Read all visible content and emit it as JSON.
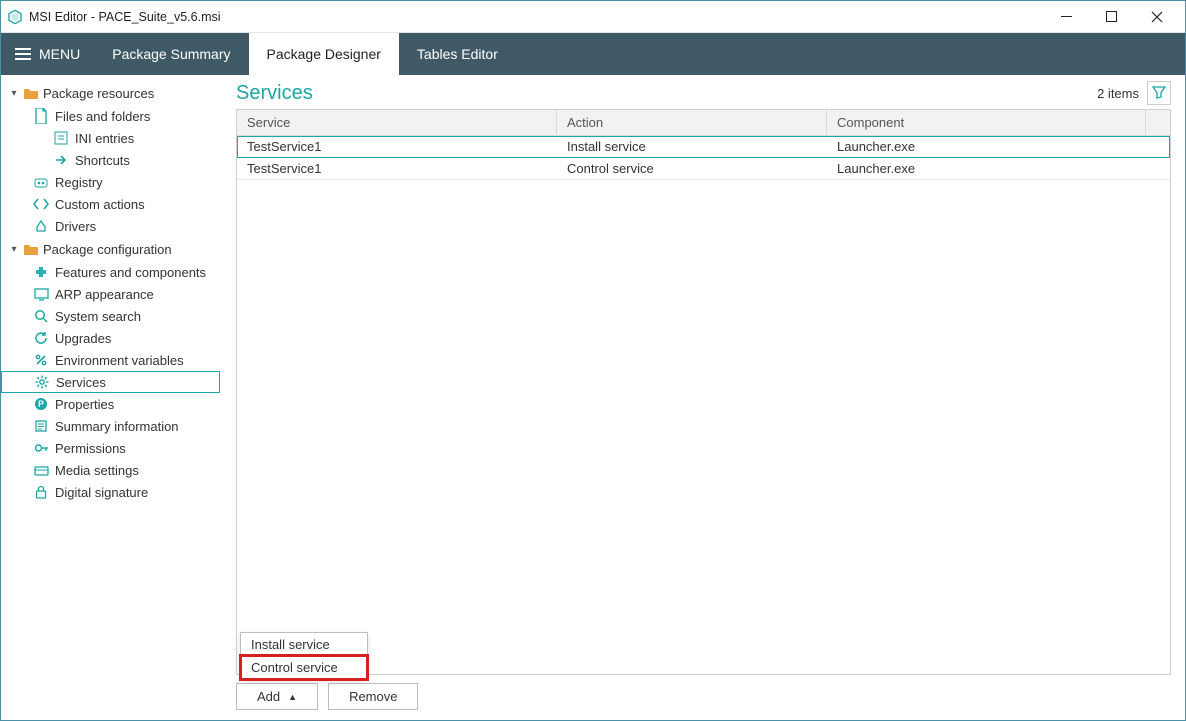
{
  "window": {
    "title": "MSI Editor - PACE_Suite_v5.6.msi"
  },
  "menubar": {
    "menu_label": "MENU",
    "tabs": [
      {
        "label": "Package Summary",
        "active": false
      },
      {
        "label": "Package Designer",
        "active": true
      },
      {
        "label": "Tables Editor",
        "active": false
      }
    ]
  },
  "sidebar": {
    "sections": [
      {
        "label": "Package resources",
        "items": [
          {
            "label": "Files and folders",
            "icon": "file"
          },
          {
            "label": "INI entries",
            "icon": "ini",
            "indent": 2
          },
          {
            "label": "Shortcuts",
            "icon": "shortcut",
            "indent": 2
          },
          {
            "label": "Registry",
            "icon": "registry"
          },
          {
            "label": "Custom actions",
            "icon": "code"
          },
          {
            "label": "Drivers",
            "icon": "driver"
          }
        ]
      },
      {
        "label": "Package configuration",
        "items": [
          {
            "label": "Features and components",
            "icon": "puzzle"
          },
          {
            "label": "ARP appearance",
            "icon": "monitor"
          },
          {
            "label": "System search",
            "icon": "search"
          },
          {
            "label": "Upgrades",
            "icon": "refresh"
          },
          {
            "label": "Environment variables",
            "icon": "percent"
          },
          {
            "label": "Services",
            "icon": "gear",
            "selected": true
          },
          {
            "label": "Properties",
            "icon": "prop"
          },
          {
            "label": "Summary information",
            "icon": "summary"
          },
          {
            "label": "Permissions",
            "icon": "key"
          },
          {
            "label": "Media settings",
            "icon": "media"
          },
          {
            "label": "Digital signature",
            "icon": "lock"
          }
        ]
      }
    ]
  },
  "main": {
    "title": "Services",
    "item_count_text": "2 items",
    "columns": {
      "service": "Service",
      "action": "Action",
      "component": "Component"
    },
    "rows": [
      {
        "service": "TestService1",
        "action": "Install service",
        "component": "Launcher.exe",
        "selected": true
      },
      {
        "service": "TestService1",
        "action": "Control service",
        "component": "Launcher.exe",
        "selected": false
      }
    ],
    "popup": {
      "items": [
        {
          "label": "Install service"
        },
        {
          "label": "Control service",
          "highlight": true
        }
      ]
    },
    "buttons": {
      "add": "Add",
      "remove": "Remove"
    }
  }
}
